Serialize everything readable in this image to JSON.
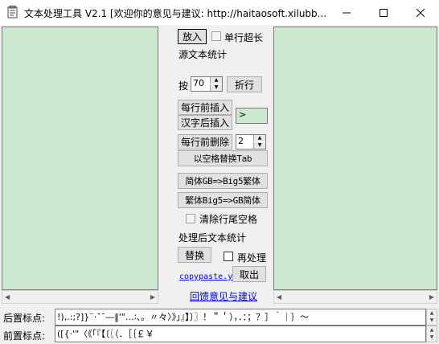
{
  "window": {
    "title": "文本处理工具 V2.1 [欢迎你的意见与建议:  http://haitaosoft.xilubb..."
  },
  "controls": {
    "put_in": "放入",
    "single_line_long": "单行超长",
    "source_stats": "源文本统计",
    "by_label": "按",
    "wrap_width": "70",
    "wrap_button": "折行",
    "insert_before_line": "每行前插入",
    "insert_after_hanzi": "汉字后插入",
    "insert_text": ">",
    "delete_before_line": "每行前删除",
    "delete_count": "2",
    "space_to_tab": "以空格替换Tab",
    "gb_to_big5": "简体GB=>Big5繁体",
    "big5_to_gb": "繁体Big5=>GB简体",
    "clear_trailing_spaces": "清除行尾空格",
    "result_stats": "处理后文本统计",
    "replace_button": "替换",
    "reprocess": "再处理",
    "copypaste_link": "copypaste.y",
    "fetch_button": "取出",
    "feedback_link": "回馈意见与建议"
  },
  "bottom": {
    "post_label": "后置标点:",
    "post_value": "!),.:;?]}¨·ˇˉ―‖'\"…∶、。〃々〉》」』】〕〗！＂＇），．：；？］｀｜｝～",
    "pre_label": "前置标点:",
    "pre_value": "([{·'\"〈《「『【〔〖（．［｛￡￥"
  }
}
